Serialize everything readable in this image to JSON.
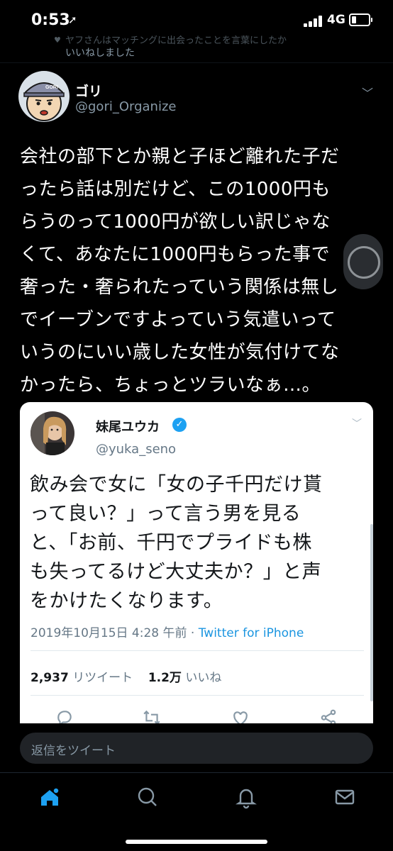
{
  "status_bar": {
    "time": "0:53",
    "network": "4G",
    "battery_level": 0.3
  },
  "context": {
    "line1": "ヤフさんはマッチングに出会ったことを言葉にしたか",
    "line2": "いいねしました"
  },
  "tweet": {
    "author_name": "ゴリ",
    "author_handle": "@gori_Organize",
    "avatar_cap_text": "GORI",
    "text": "会社の部下とか親と子ほど離れた子だ\nったら話は別だけど、この1000円も\nらうのって1000円が欲しい訳じゃな\nくて、あなたに1000円もらった事で\n奢った・奢られたっていう関係は無し\nでイーブンですよっていう気遣いって\nいうのにいい歳した女性が気付けてな\nかったら、ちょっとツラいなぁ…。"
  },
  "quoted_tweet": {
    "author_name": "妹尾ユウカ",
    "verified_mark": "✓",
    "author_handle": "@yuka_seno",
    "text": "飲み会で女に「女の子千円だけ貰\nって良い？」って言う男を見る\nと、「お前、千円でプライドも株\nも失ってるけど大丈夫か？」と声\nをかけたくなります。",
    "timestamp": "2019年10月15日 4:28 午前 · ",
    "source": "Twitter for iPhone",
    "retweets_count": "2,937",
    "retweets_label": "リツイート",
    "likes_count": "1.2万",
    "likes_label": "いいね",
    "action_icons": [
      "reply-icon",
      "retweet-icon",
      "like-icon",
      "share-icon"
    ]
  },
  "reply": {
    "placeholder": "返信をツイート"
  },
  "tabbar": {
    "icons": [
      "home-icon",
      "search-icon",
      "notifications-icon",
      "messages-icon"
    ]
  },
  "colors": {
    "background": "#000000",
    "secondary_text": "#8899a6",
    "accent": "#1da1f2",
    "link": "#1b95e0"
  }
}
